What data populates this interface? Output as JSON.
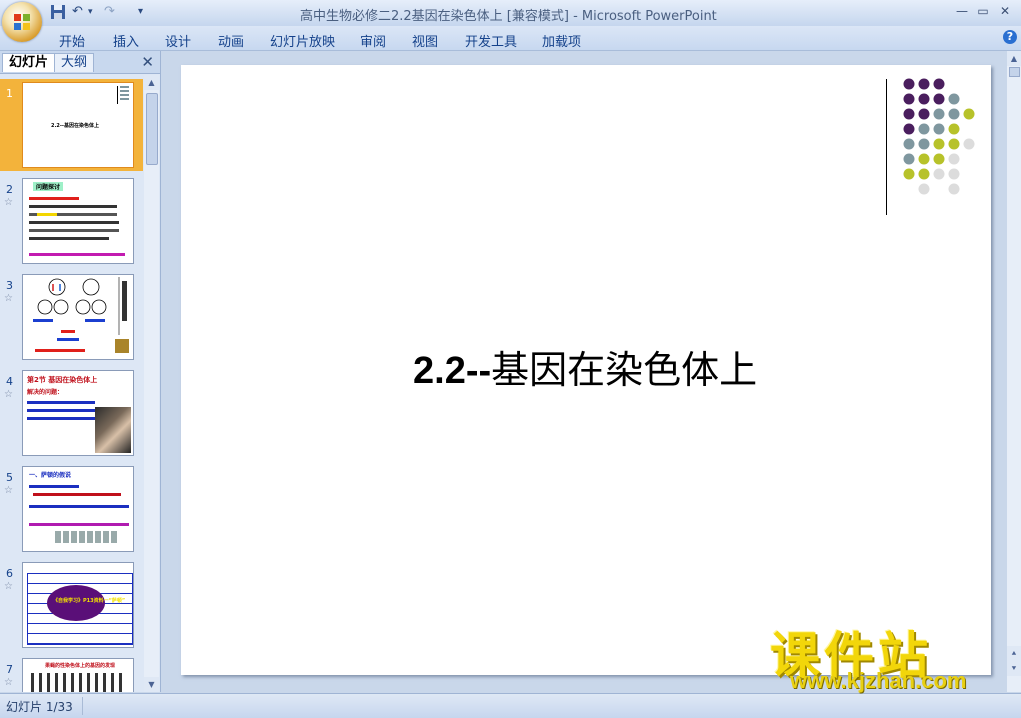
{
  "window": {
    "title": "高中生物必修二2.2基因在染色体上 [兼容模式] - Microsoft PowerPoint",
    "minimize": "—",
    "restore": "▭",
    "close": "✕"
  },
  "quick_access": {
    "save_icon": "save-icon",
    "undo": "↶",
    "redo": "↷",
    "customize": "▾"
  },
  "ribbon_tabs": [
    "开始",
    "插入",
    "设计",
    "动画",
    "幻灯片放映",
    "审阅",
    "视图",
    "开发工具",
    "加载项"
  ],
  "help": "?",
  "pane_tabs": {
    "slides": "幻灯片",
    "outline": "大纲",
    "close": "✕"
  },
  "slide_numbers": [
    "1",
    "2",
    "3",
    "4",
    "5",
    "6",
    "7"
  ],
  "transition_mark": "☆",
  "thumbnails": {
    "s1_title": "2.2--基因在染色体上",
    "s2_label": "问题探讨",
    "s4_title": "第2节  基因在染色体上",
    "s4_sub": "解决的问题：",
    "s5_heading": "一、萨顿的假说",
    "s6_banner": "《自我学习》P13资料一“萨顿”",
    "s7_heading": "果蝇的性染色体上的基因的发现"
  },
  "slide": {
    "title_prefix": "2.2--",
    "title_main": "基因在染色体上",
    "accent_colors": {
      "purple": "#4a1e5e",
      "gray": "#7f979f",
      "olive": "#b7c22a",
      "light": "#dcdcdc"
    }
  },
  "status": {
    "slide_counter": "幻灯片 1/33"
  },
  "watermark": {
    "name": "课件站",
    "url": "www.kjzhan.com"
  }
}
